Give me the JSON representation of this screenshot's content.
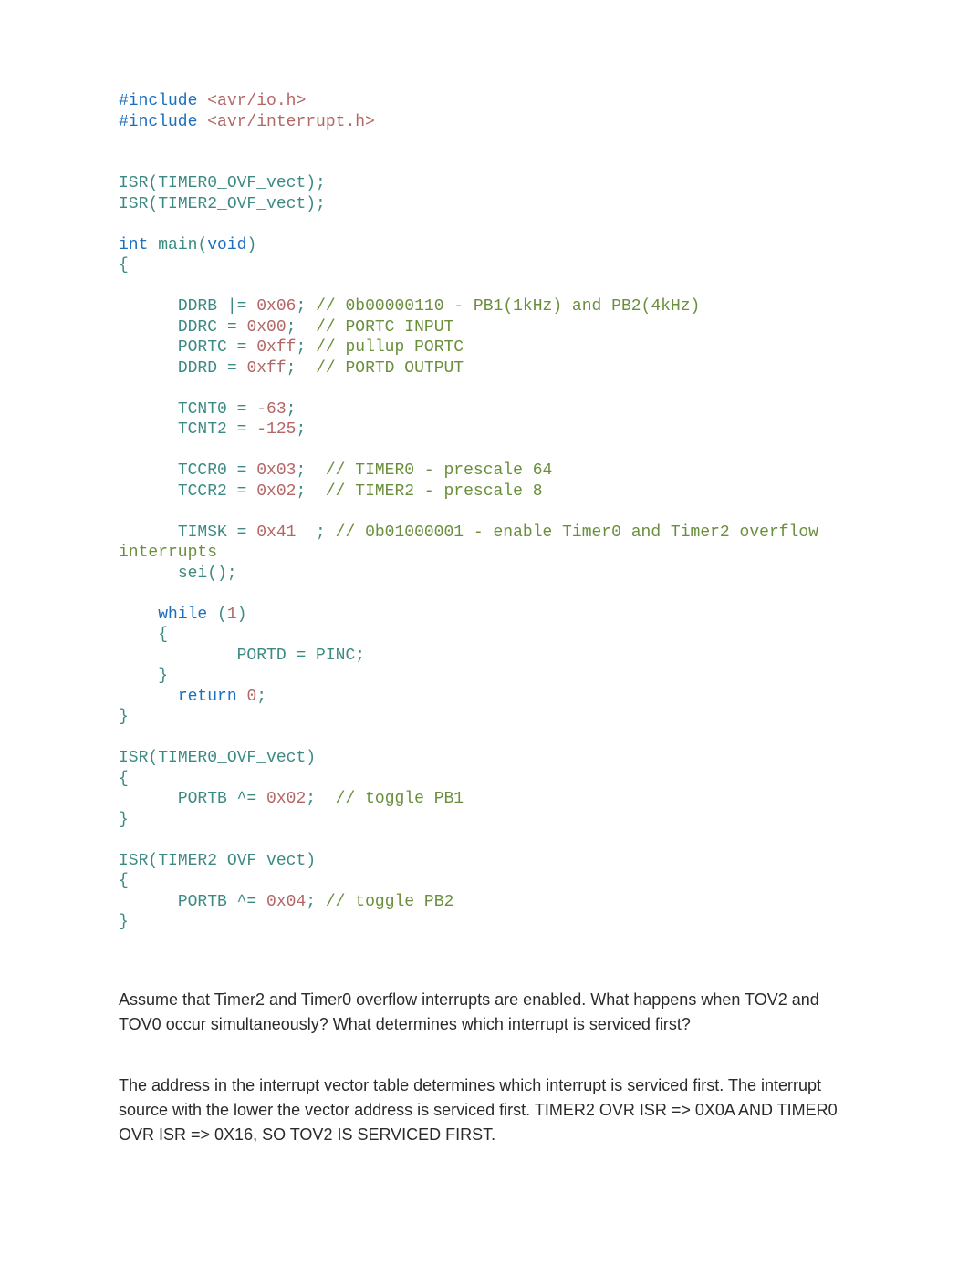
{
  "code": {
    "include1_pre": "#include",
    "include1_hdr": " <avr/io.h>",
    "include2_pre": "#include",
    "include2_hdr": " <avr/interrupt.h>",
    "isr_decl1_isr": "ISR",
    "isr_decl1_p1": "(",
    "isr_decl1_arg": "TIMER0_OVF_vect",
    "isr_decl1_p2": ");",
    "isr_decl2_isr": "ISR",
    "isr_decl2_p1": "(",
    "isr_decl2_arg": "TIMER2_OVF_vect",
    "isr_decl2_p2": ");",
    "main_int": "int",
    "main_sp": " ",
    "main_name": "main",
    "main_p1": "(",
    "main_void": "void",
    "main_p2": ")",
    "brace_open": "{",
    "brace_close": "}",
    "ddrb_lhs": "DDRB",
    "ddrb_op": " |= ",
    "ddrb_val": "0x06",
    "ddrb_semi": ";",
    "ddrb_cmt": " // 0b00000110 - PB1(1kHz) and PB2(4kHz)",
    "ddrc_lhs": "DDRC",
    "ddrc_op": " = ",
    "ddrc_val": "0x00",
    "ddrc_semi": ";",
    "ddrc_cmt": "  // PORTC INPUT",
    "portc_lhs": "PORTC",
    "portc_op": " = ",
    "portc_val": "0xff",
    "portc_semi": ";",
    "portc_cmt": " // pullup PORTC",
    "ddrd_lhs": "DDRD",
    "ddrd_op": " = ",
    "ddrd_val": "0xff",
    "ddrd_semi": ";",
    "ddrd_cmt": "  // PORTD OUTPUT",
    "tcnt0_lhs": "TCNT0",
    "tcnt0_op": " = ",
    "tcnt0_val": "-63",
    "tcnt0_semi": ";",
    "tcnt2_lhs": "TCNT2",
    "tcnt2_op": " = ",
    "tcnt2_val": "-125",
    "tcnt2_semi": ";",
    "tccr0_lhs": "TCCR0",
    "tccr0_op": " = ",
    "tccr0_val": "0x03",
    "tccr0_semi": ";",
    "tccr0_cmt": "  // TIMER0 - prescale 64",
    "tccr2_lhs": "TCCR2",
    "tccr2_op": " = ",
    "tccr2_val": "0x02",
    "tccr2_semi": ";",
    "tccr2_cmt": "  // TIMER2 - prescale 8",
    "timsk_lhs": "TIMSK",
    "timsk_op": " = ",
    "timsk_val": "0x41",
    "timsk_semi": "  ;",
    "timsk_cmt1": " // 0b01000001 - enable Timer0 and Timer2 overflow ",
    "timsk_cmt2": "interrupts",
    "sei_call": "sei",
    "sei_p": "();",
    "while_kw": "while",
    "while_sp": " (",
    "while_cond": "1",
    "while_p2": ")",
    "portd_lhs": "PORTD",
    "portd_op": " = ",
    "portd_rhs": "PINC",
    "portd_semi": ";",
    "return_kw": "return",
    "return_sp": " ",
    "return_val": "0",
    "return_semi": ";",
    "isr0_isr": "ISR",
    "isr0_p1": "(",
    "isr0_arg": "TIMER0_OVF_vect",
    "isr0_p2": ")",
    "portb0_lhs": "PORTB",
    "portb0_op": " ^= ",
    "portb0_val": "0x02",
    "portb0_semi": ";",
    "portb0_cmt": "  // toggle PB1",
    "isr2_isr": "ISR",
    "isr2_p1": "(",
    "isr2_arg": "TIMER2_OVF_vect",
    "isr2_p2": ")",
    "portb2_lhs": "PORTB",
    "portb2_op": " ^= ",
    "portb2_val": "0x04",
    "portb2_semi": ";",
    "portb2_cmt": " // toggle PB2"
  },
  "question": "Assume that Timer2 and Timer0 overflow interrupts are enabled.  What happens when TOV2 and TOV0 occur simultaneously?  What determines which interrupt is serviced first?",
  "answer": "The address in the interrupt vector table determines which interrupt is serviced first.  The interrupt source with the lower the vector address is serviced first.  TIMER2 OVR ISR => 0X0A AND TIMER0 OVR ISR => 0X16, SO TOV2 IS SERVICED FIRST."
}
